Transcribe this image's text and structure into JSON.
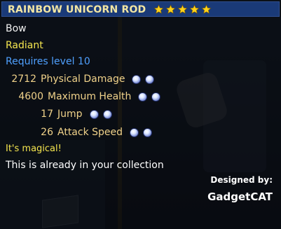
{
  "item": {
    "name": "RAINBOW UNICORN ROD",
    "star_count": 5,
    "type": "Bow",
    "rarity": "Radiant",
    "requirement": "Requires level 10",
    "stats": [
      {
        "value": "2712",
        "label": "Physical Damage",
        "gems": 2
      },
      {
        "value": "4600",
        "label": "Maximum Health",
        "gems": 2
      },
      {
        "value": "17",
        "label": "Jump",
        "gems": 2
      },
      {
        "value": "26",
        "label": "Attack Speed",
        "gems": 2
      }
    ],
    "flavor": "It's magical!",
    "collection_note": "This is already in your collection",
    "designed_by_label": "Designed by:",
    "designer": "GadgetCAT"
  },
  "colors": {
    "title_bar": "#1a3a78",
    "title_text": "#f3e6a3",
    "star": "#ffd21a",
    "rarity": "#f5e64f",
    "requirement": "#4fa0ff",
    "stat_text": "#f0d28a"
  },
  "icons": {
    "star": "star-icon",
    "gem": "gem-icon"
  }
}
